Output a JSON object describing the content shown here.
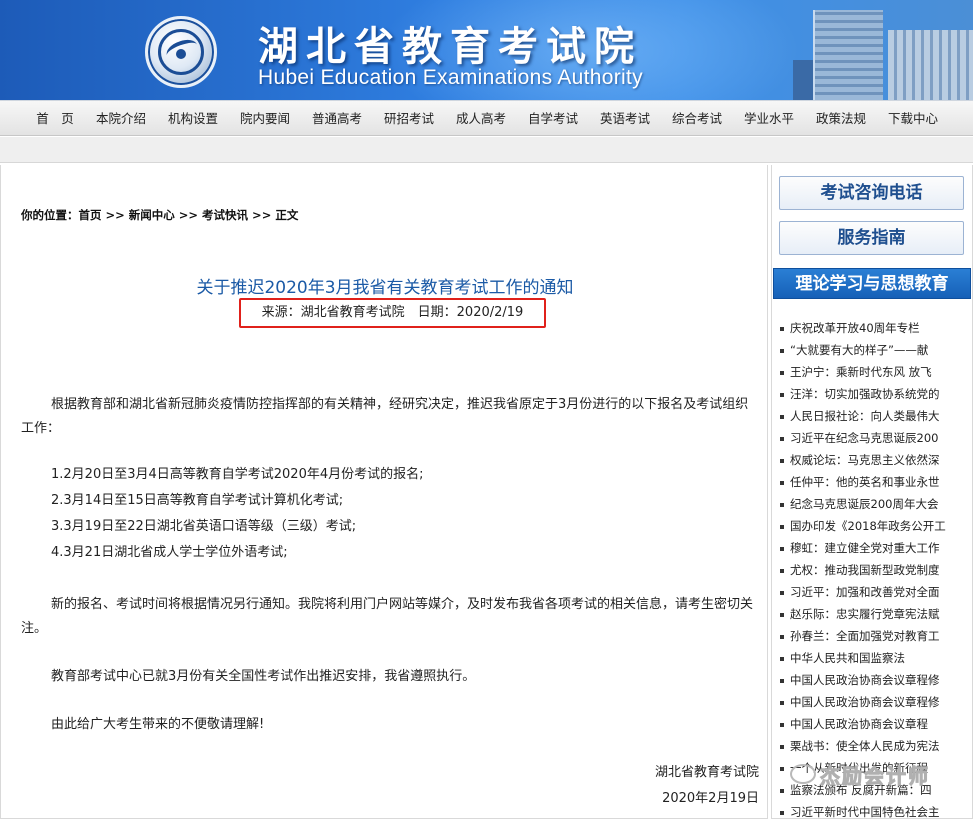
{
  "header": {
    "title_cn": "湖北省教育考试院",
    "title_en": "Hubei Education Examinations Authority",
    "logo_icon": "emblem-logo"
  },
  "nav": {
    "items": [
      "首　页",
      "本院介绍",
      "机构设置",
      "院内要闻",
      "普通高考",
      "研招考试",
      "成人高考",
      "自学考试",
      "英语考试",
      "综合考试",
      "学业水平",
      "政策法规",
      "下载中心"
    ]
  },
  "breadcrumb": "你的位置：首页 >> 新闻中心 >> 考试快讯 >> 正文",
  "article": {
    "title": "关于推迟2020年3月我省有关教育考试工作的通知",
    "meta": "来源：湖北省教育考试院　日期：2020/2/19",
    "meta_highlight_color": "#e0211b",
    "intro": "根据教育部和湖北省新冠肺炎疫情防控指挥部的有关精神，经研究决定，推迟我省原定于3月份进行的以下报名及考试组织工作：",
    "items": [
      "1.2月20日至3月4日高等教育自学考试2020年4月份考试的报名;",
      "2.3月14日至15日高等教育自学考试计算机化考试;",
      "3.3月19日至22日湖北省英语口语等级（三级）考试;",
      "4.3月21日湖北省成人学士学位外语考试;"
    ],
    "para2": "新的报名、考试时间将根据情况另行通知。我院将利用门户网站等媒介，及时发布我省各项考试的相关信息，请考生密切关注。",
    "para3": "教育部考试中心已就3月份有关全国性考试作出推迟安排，我省遵照执行。",
    "para4": "由此给广大考生带来的不便敬请理解!",
    "sign_org": "湖北省教育考试院",
    "sign_date": "2020年2月19日"
  },
  "sidebar": {
    "button1": "考试咨询电话",
    "button2": "服务指南",
    "section_title": "理论学习与思想教育",
    "links": [
      "庆祝改革开放40周年专栏",
      "“大就要有大的样子”——献",
      "王沪宁：乘新时代东风 放飞",
      "汪洋：切实加强政协系统党的",
      "人民日报社论：向人类最伟大",
      "习近平在纪念马克思诞辰200",
      "权威论坛：马克思主义依然深",
      "任仲平：他的英名和事业永世",
      "纪念马克思诞辰200周年大会",
      "国办印发《2018年政务公开工",
      "穆虹：建立健全党对重大工作",
      "尤权：推动我国新型政党制度",
      "习近平：加强和改善党对全面",
      "赵乐际：忠实履行党章宪法赋",
      "孙春兰：全面加强党对教育工",
      "中华人民共和国监察法",
      "中国人民政治协商会议章程修",
      "中国人民政治协商会议章程修",
      "中国人民政治协商会议章程",
      "栗战书：使全体人民成为宪法",
      "一个从新时代出发的新征程",
      "监察法颁布 反腐开新篇：四",
      "习近平新时代中国特色社会主"
    ]
  },
  "watermark": "杰励会计师"
}
